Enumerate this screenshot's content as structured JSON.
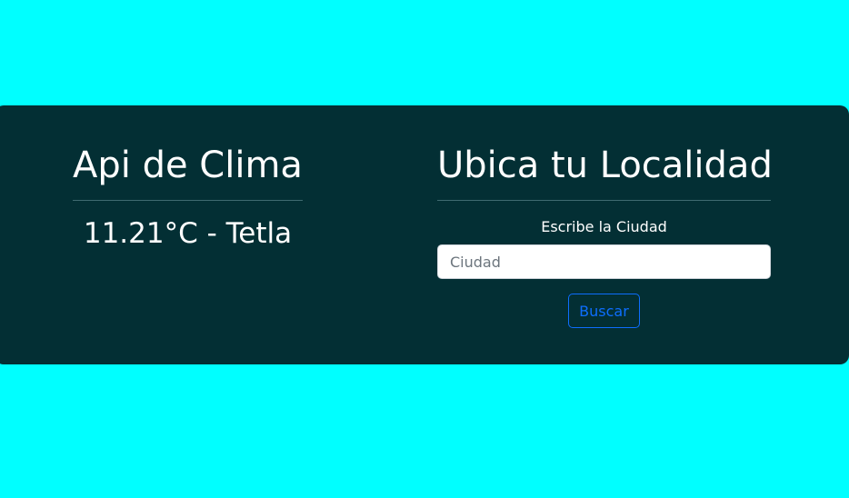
{
  "colors": {
    "page_background": "#00ffff",
    "card_background": "#032f34",
    "text": "#ffffff",
    "button": "#0d6efd"
  },
  "weather_panel": {
    "title": "Api de Clima",
    "result": "11.21°C - Tetla"
  },
  "search_panel": {
    "title": "Ubica tu Localidad",
    "label": "Escribe la Ciudad",
    "input_placeholder": "Ciudad",
    "input_value": "",
    "button_label": "Buscar"
  }
}
